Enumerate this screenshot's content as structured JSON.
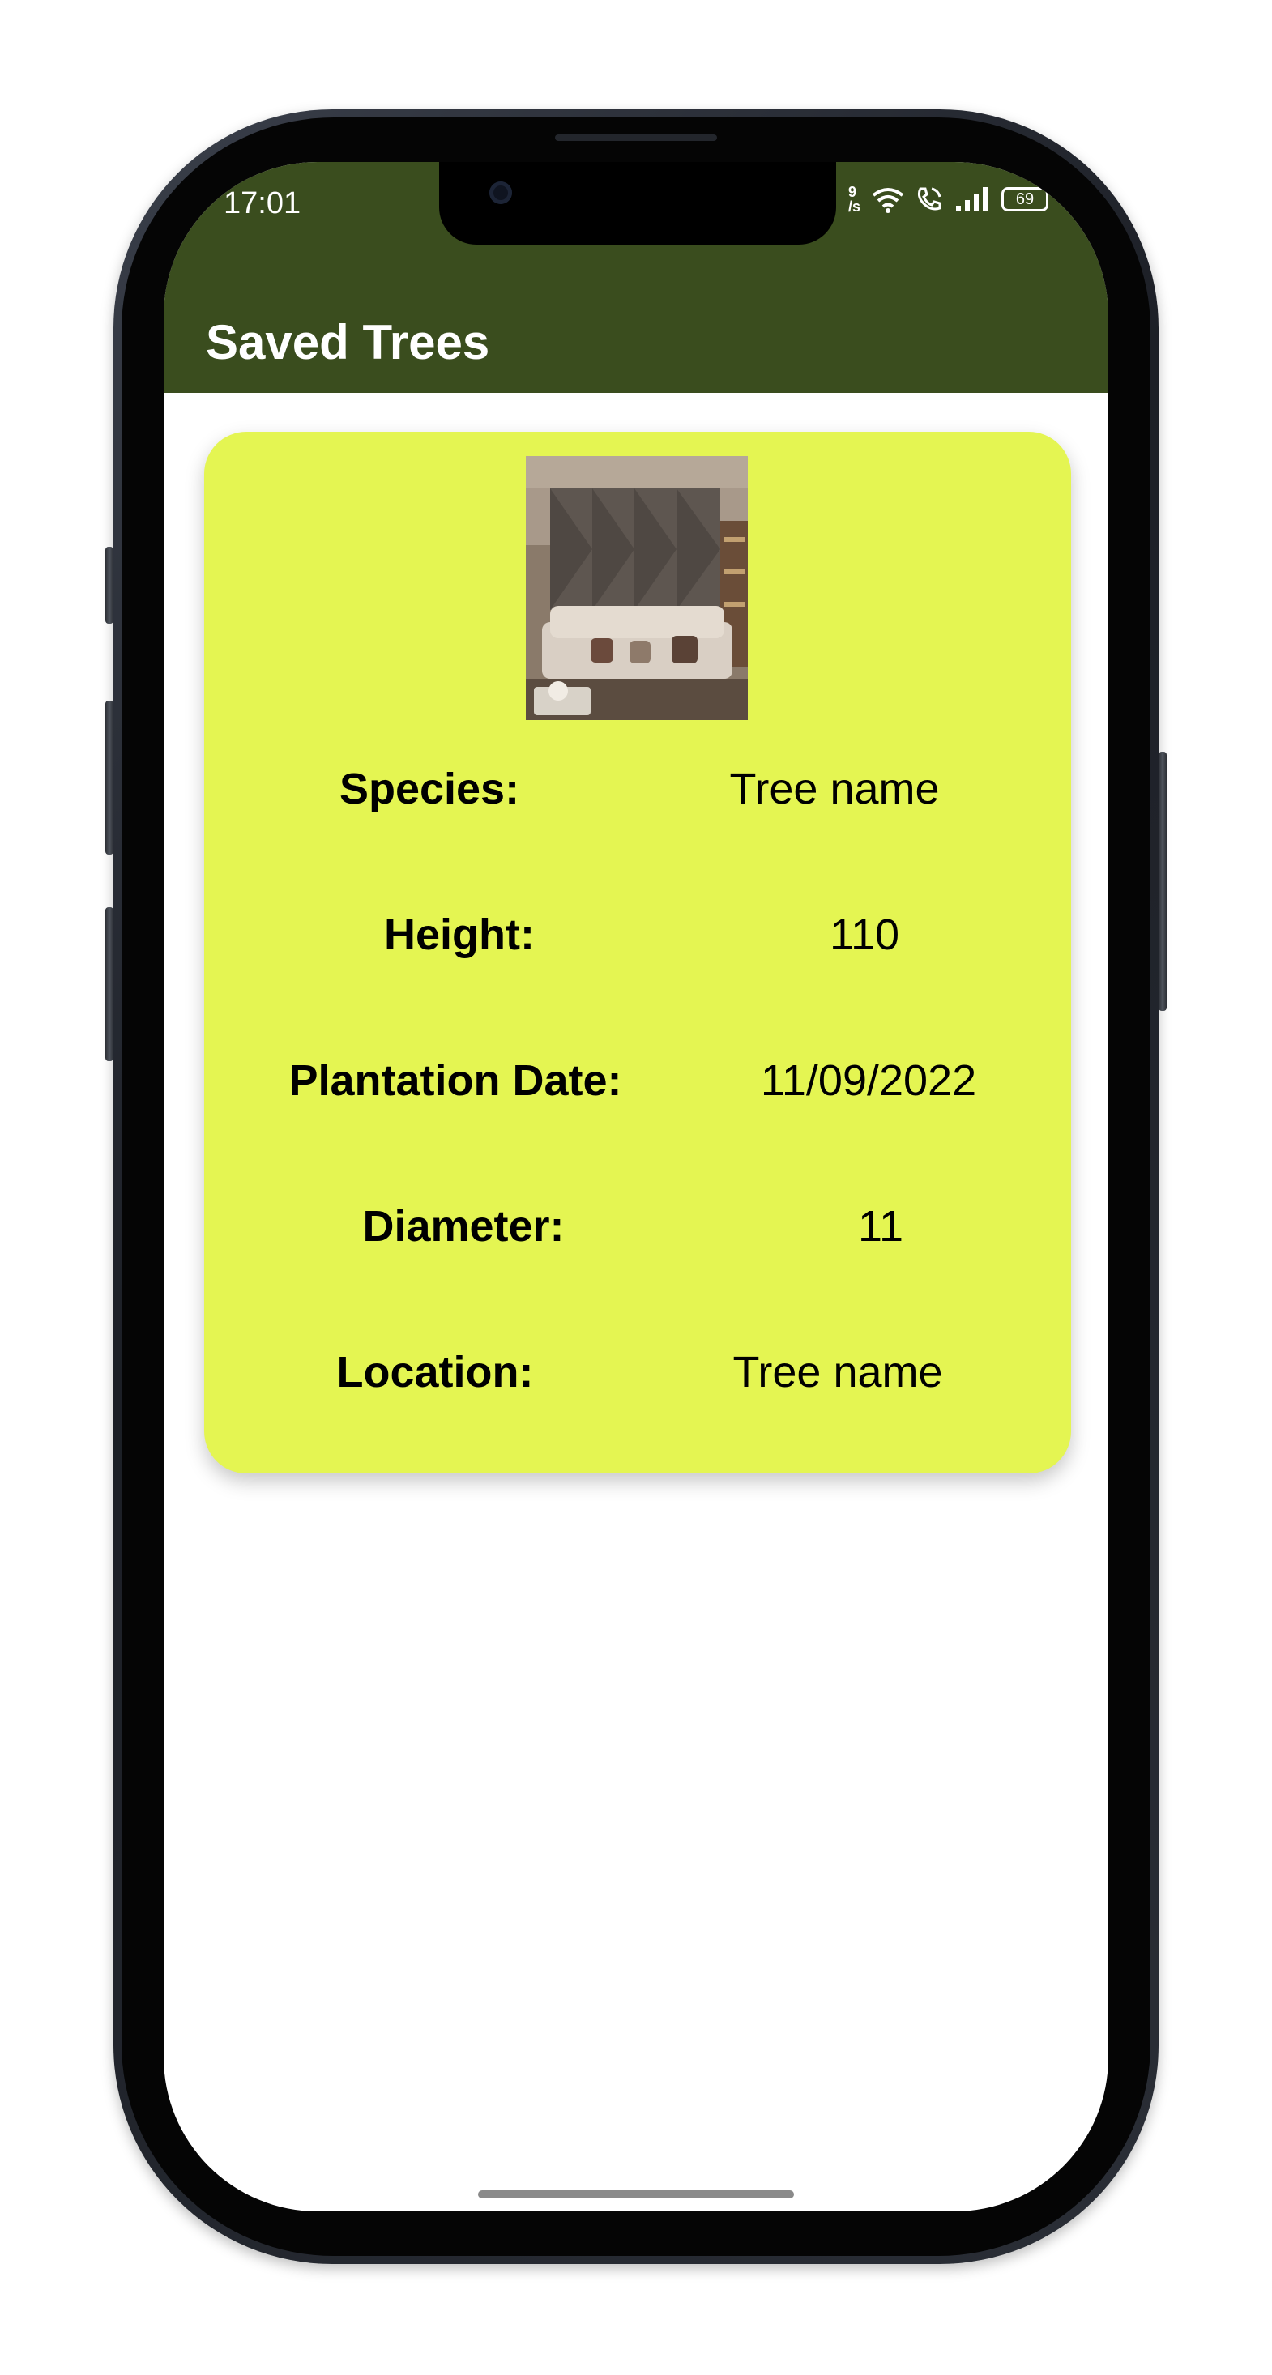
{
  "status_bar": {
    "time": "17:01",
    "net_speed_top": "9",
    "net_speed_bottom": "/s",
    "battery": "69"
  },
  "app_bar": {
    "title": "Saved Trees"
  },
  "card": {
    "image_alt": "tree photo",
    "rows": [
      {
        "label": "Species:",
        "value": "Tree name"
      },
      {
        "label": "Height:",
        "value": "110"
      },
      {
        "label": "Plantation Date:",
        "value": "11/09/2022"
      },
      {
        "label": "Diameter:",
        "value": "11"
      },
      {
        "label": "Location:",
        "value": "Tree name"
      }
    ]
  },
  "colors": {
    "app_bar": "#3a4d1e",
    "card": "#e4f552"
  },
  "icons": {
    "wifi": "wifi-icon",
    "call": "wifi-call-icon",
    "signal": "signal-icon",
    "battery": "battery-icon"
  }
}
